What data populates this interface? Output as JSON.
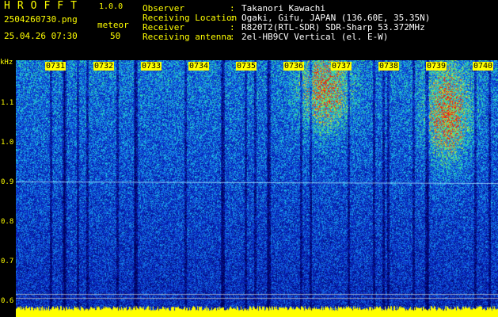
{
  "app": {
    "title": "HROFFT",
    "version": "1.0.0",
    "filename": "2504260730.png",
    "datetime": "25.04.26 07:30",
    "meteor_label": "meteor",
    "meteor_count": "50"
  },
  "info": [
    {
      "label": "Observer",
      "value": "Takanori Kawachi"
    },
    {
      "label": "Receiving Location",
      "value": "Ogaki, Gifu, JAPAN (136.60E, 35.35N)"
    },
    {
      "label": "Receiver",
      "value": "R820T2(RTL-SDR) SDR-Sharp 53.372MHz"
    },
    {
      "label": "Receiving antenna",
      "value": "2el-HB9CV Vertical (el. E-W)"
    }
  ],
  "axis": {
    "unit": "kHz",
    "ticks": [
      "1.1",
      "1.0",
      "0.9",
      "0.8",
      "0.7",
      "0.6"
    ],
    "time_labels": [
      "0731",
      "0732",
      "0733",
      "0734",
      "0735",
      "0736",
      "0737",
      "0738",
      "0739",
      "0740"
    ]
  },
  "colors": {
    "background": "#000000",
    "text_yellow": "#ffff00",
    "text_white": "#ffffff",
    "spectrogram_base": "#0a2a9a"
  }
}
